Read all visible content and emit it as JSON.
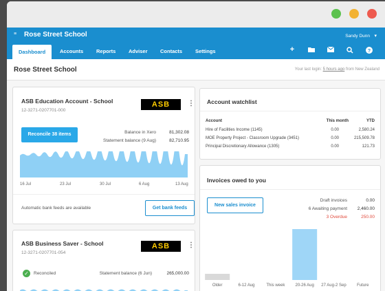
{
  "window": {
    "controls": [
      "close",
      "minimize",
      "maximize"
    ]
  },
  "nav": {
    "menu_icon": "≡",
    "org_name": "Rose Street School",
    "user": "Sandy Dunn",
    "tabs": [
      "Dashboard",
      "Accounts",
      "Reports",
      "Adviser",
      "Contacts",
      "Settings"
    ],
    "active_tab": "Dashboard",
    "icons": [
      "plus-icon",
      "folder-icon",
      "mail-icon",
      "search-icon",
      "help-icon"
    ]
  },
  "page": {
    "title": "Rose Street School",
    "last_login_prefix": "Your last login:",
    "last_login_time": "5 hours ago",
    "last_login_suffix": "from New Zealand"
  },
  "account1": {
    "name": "ASB Education Account - School",
    "number": "12-3271-0207701-000",
    "logo": "ASB",
    "reconcile_label": "Reconcile 38 items",
    "balance_xero_label": "Balance in Xero",
    "balance_xero": "81,302.08",
    "statement_label": "Statement balance (9 Aug)",
    "statement_balance": "82,710.95",
    "chart_dates": [
      "16 Jul",
      "23 Jul",
      "30 Jul",
      "6 Aug",
      "13 Aug"
    ],
    "feed_text": "Automatic bank feeds are available",
    "feed_button": "Get bank feeds"
  },
  "account2": {
    "name": "ASB Business Saver - School",
    "number": "12-3271-0207701-054",
    "logo": "ASB",
    "reconciled_label": "Reconciled",
    "statement_label": "Statement balance (6 Jun)",
    "statement_balance": "265,000.00"
  },
  "watchlist": {
    "title": "Account watchlist",
    "headers": [
      "Account",
      "This month",
      "YTD"
    ],
    "rows": [
      {
        "account": "Hire of Facilities Income (1145)",
        "month": "0.00",
        "ytd": "2,580.24"
      },
      {
        "account": "MOE Property Project - Classroom Upgrade (3451)",
        "month": "0.00",
        "ytd": "215,509.78"
      },
      {
        "account": "Principal Discretionary Allowance (1305)",
        "month": "0.00",
        "ytd": "121.73"
      }
    ]
  },
  "invoices": {
    "title": "Invoices owed to you",
    "new_button": "New sales invoice",
    "summary": [
      {
        "label": "Draft invoices",
        "value": "0.00",
        "color": "#666666"
      },
      {
        "label": "6 Awaiting payment",
        "value": "2,460.00",
        "color": "#666666"
      },
      {
        "label": "3 Overdue",
        "value": "250.00",
        "color": "#e0483a"
      }
    ]
  },
  "chart_data": {
    "type": "bar",
    "categories": [
      "Older",
      "6-12 Aug",
      "This week",
      "20-26 Aug",
      "27 Aug-2 Sep",
      "Future"
    ],
    "values": [
      180,
      0,
      0,
      1480,
      0,
      0
    ],
    "colors": [
      "#d9d9d9",
      "#9fd6f7",
      "#9fd6f7",
      "#9fd6f7",
      "#9fd6f7",
      "#9fd6f7"
    ],
    "ylim": [
      0,
      1600
    ]
  }
}
